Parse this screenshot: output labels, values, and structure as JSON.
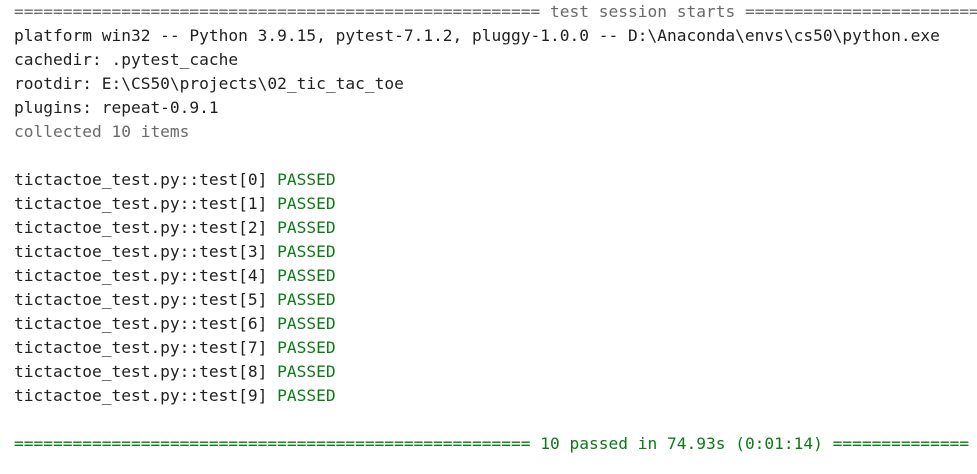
{
  "header": {
    "rule_left": "======================================================",
    "title": "test session starts",
    "rule_right": "======================================================"
  },
  "info": {
    "platform": "platform win32 -- Python 3.9.15, pytest-7.1.2, pluggy-1.0.0 -- D:\\Anaconda\\envs\\cs50\\python.exe",
    "cachedir": "cachedir: .pytest_cache",
    "rootdir": "rootdir: E:\\CS50\\projects\\02_tic_tac_toe",
    "plugins": "plugins: repeat-0.9.1",
    "collected": "collected 10 items"
  },
  "tests": [
    {
      "name": "tictactoe_test.py::test[0]",
      "status": "PASSED"
    },
    {
      "name": "tictactoe_test.py::test[1]",
      "status": "PASSED"
    },
    {
      "name": "tictactoe_test.py::test[2]",
      "status": "PASSED"
    },
    {
      "name": "tictactoe_test.py::test[3]",
      "status": "PASSED"
    },
    {
      "name": "tictactoe_test.py::test[4]",
      "status": "PASSED"
    },
    {
      "name": "tictactoe_test.py::test[5]",
      "status": "PASSED"
    },
    {
      "name": "tictactoe_test.py::test[6]",
      "status": "PASSED"
    },
    {
      "name": "tictactoe_test.py::test[7]",
      "status": "PASSED"
    },
    {
      "name": "tictactoe_test.py::test[8]",
      "status": "PASSED"
    },
    {
      "name": "tictactoe_test.py::test[9]",
      "status": "PASSED"
    }
  ],
  "summary": {
    "rule_left": "=====================================================",
    "text": "10 passed in 74.93s (0:01:14)",
    "rule_right": "=============="
  },
  "colors": {
    "pass": "#0b7a16",
    "muted": "#6a6a6a"
  }
}
